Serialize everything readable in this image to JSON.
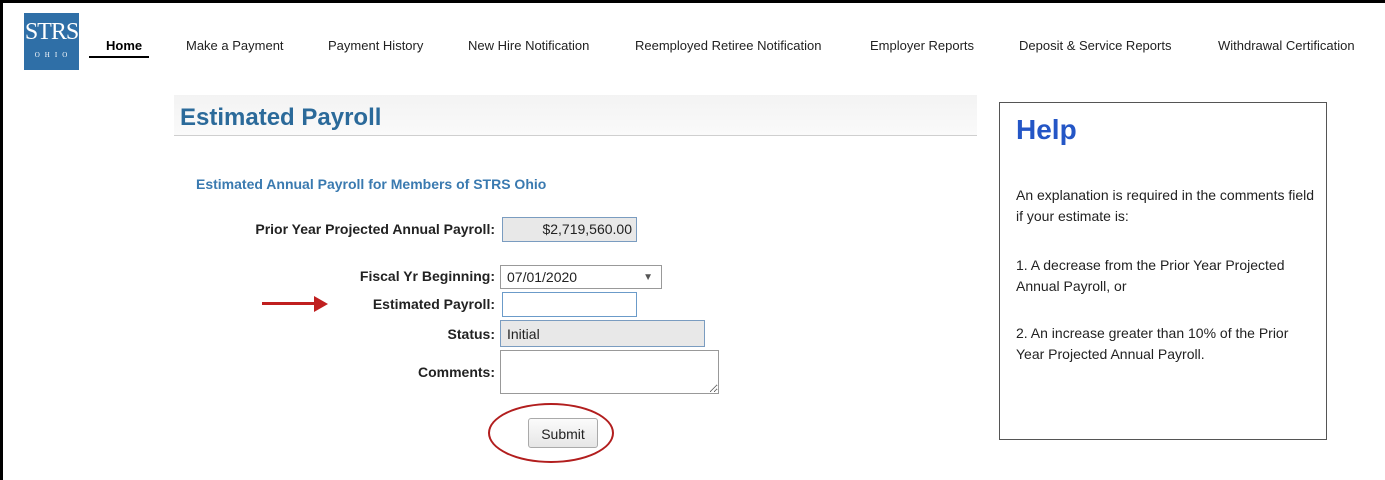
{
  "logo": {
    "main": "STRS",
    "sub": "OHIO"
  },
  "nav": {
    "items": [
      {
        "label": "Home"
      },
      {
        "label": "Make a Payment"
      },
      {
        "label": "Payment History"
      },
      {
        "label": "New Hire Notification"
      },
      {
        "label": "Reemployed Retiree Notification"
      },
      {
        "label": "Employer Reports"
      },
      {
        "label": "Deposit & Service Reports"
      },
      {
        "label": "Withdrawal Certification"
      }
    ]
  },
  "page": {
    "title": "Estimated Payroll",
    "subtitle": "Estimated Annual Payroll for Members of STRS Ohio"
  },
  "form": {
    "prior_label": "Prior Year Projected Annual Payroll:",
    "prior_value": "$2,719,560.00",
    "fiscal_label": "Fiscal Yr Beginning:",
    "fiscal_value": "07/01/2020",
    "estimated_label": "Estimated Payroll:",
    "estimated_value": "",
    "status_label": "Status:",
    "status_value": "Initial",
    "comments_label": "Comments:",
    "comments_value": "",
    "submit_label": "Submit"
  },
  "help": {
    "title": "Help",
    "intro": "An explanation is required in the comments field if your estimate is:",
    "item1": "1. A decrease from the Prior Year Projected Annual Payroll, or",
    "item2": "2. An increase greater than 10% of the Prior Year Projected Annual Payroll."
  },
  "colors": {
    "brand_blue": "#2f6fa7",
    "title_blue": "#2b6a9a",
    "help_blue": "#2456c6",
    "annotation_red": "#c01f1f"
  },
  "icons": {
    "dropdown": "chevron-down-icon",
    "annotation_arrow": "arrow-right-icon"
  }
}
